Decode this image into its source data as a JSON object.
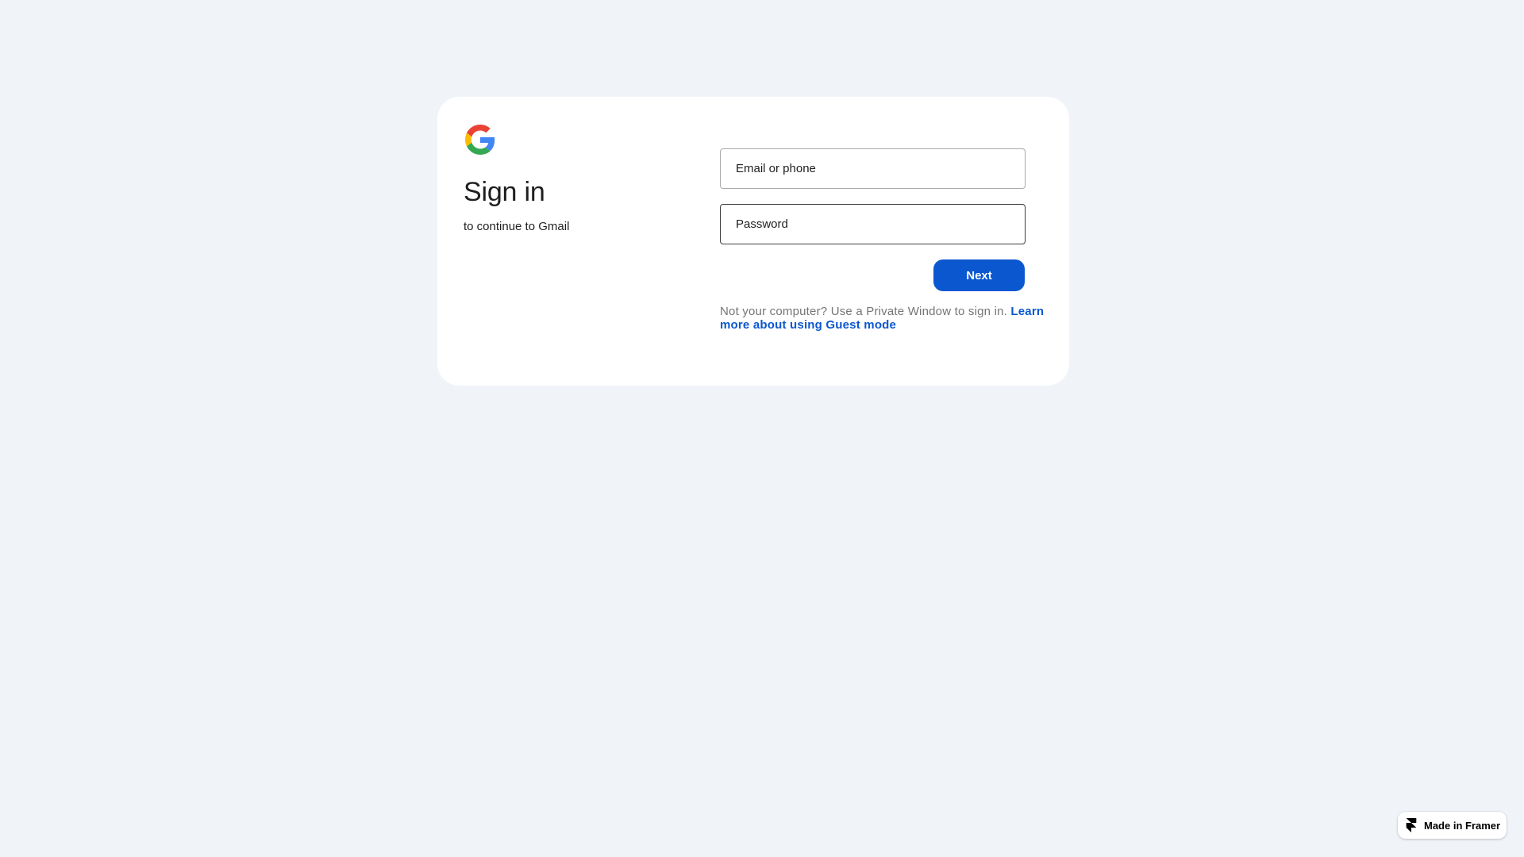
{
  "card": {
    "title": "Sign in",
    "subtitle": "to continue to Gmail",
    "logo_icon": "google-g-icon"
  },
  "form": {
    "email_placeholder": "Email or phone",
    "password_placeholder": "Password",
    "next_label": "Next"
  },
  "notice": {
    "text": "Not your computer? Use a Private Window to sign in. ",
    "link_text": "Learn more about using Guest mode"
  },
  "badge": {
    "label": "Made in Framer",
    "icon": "framer-icon"
  },
  "colors": {
    "background": "#f0f4f9",
    "accent": "#0b57d0",
    "card": "#ffffff"
  }
}
